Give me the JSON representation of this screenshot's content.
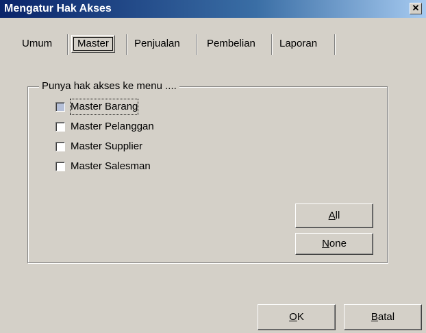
{
  "window": {
    "title": "Mengatur Hak Akses",
    "close_symbol": "✕"
  },
  "tabs": [
    {
      "label": "Umum",
      "selected": false
    },
    {
      "label": "Master",
      "selected": true
    },
    {
      "label": "Penjualan",
      "selected": false
    },
    {
      "label": "Pembelian",
      "selected": false
    },
    {
      "label": "Laporan",
      "selected": false
    }
  ],
  "group": {
    "legend": "Punya hak akses ke menu ....",
    "items": [
      {
        "label": "Master Barang",
        "checked": false,
        "focused": true
      },
      {
        "label": "Master Pelanggan",
        "checked": false,
        "focused": false
      },
      {
        "label": "Master Supplier",
        "checked": false,
        "focused": false
      },
      {
        "label": "Master Salesman",
        "checked": false,
        "focused": false
      }
    ],
    "all_button": {
      "mnemonic": "A",
      "rest": "ll"
    },
    "none_button": {
      "mnemonic": "N",
      "rest": "one"
    }
  },
  "footer": {
    "ok_button": {
      "mnemonic": "O",
      "rest": "K"
    },
    "cancel_button": {
      "mnemonic": "B",
      "rest": "atal"
    }
  }
}
